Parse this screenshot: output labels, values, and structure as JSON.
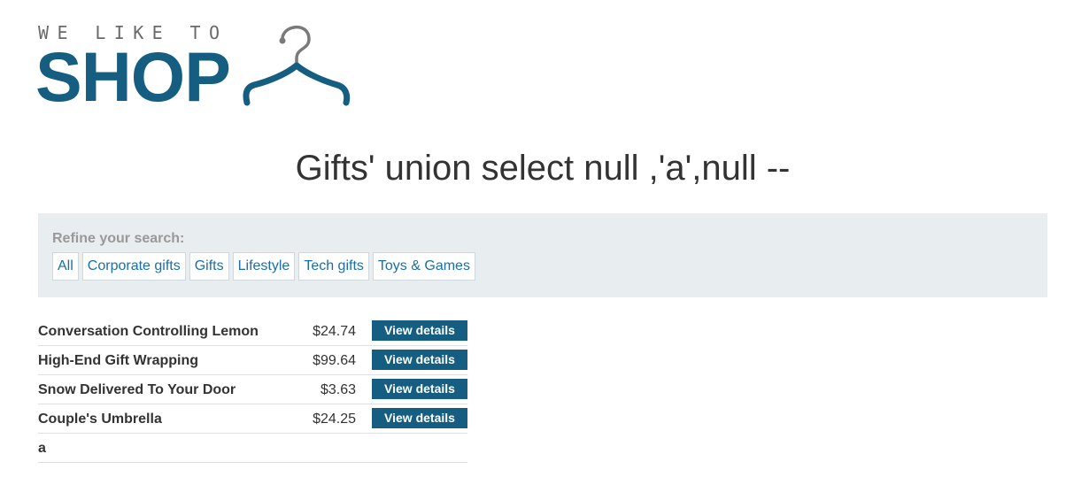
{
  "logo": {
    "tagline": "WE LIKE TO",
    "word": "SHOP",
    "colors": {
      "brand": "#155e82",
      "hook": "#7a7a7a",
      "tagline": "#6a6a6a"
    },
    "icon": "hanger-icon"
  },
  "page_title": "Gifts' union select null ,'a',null --",
  "filters": {
    "label": "Refine your search:",
    "items": [
      {
        "label": "All"
      },
      {
        "label": "Corporate gifts"
      },
      {
        "label": "Gifts"
      },
      {
        "label": "Lifestyle"
      },
      {
        "label": "Tech gifts"
      },
      {
        "label": "Toys & Games"
      }
    ]
  },
  "products": [
    {
      "name": "Conversation Controlling Lemon",
      "price": "$24.74",
      "button": "View details"
    },
    {
      "name": "High-End Gift Wrapping",
      "price": "$99.64",
      "button": "View details"
    },
    {
      "name": "Snow Delivered To Your Door",
      "price": "$3.63",
      "button": "View details"
    },
    {
      "name": "Couple's Umbrella",
      "price": "$24.25",
      "button": "View details"
    },
    {
      "name": "a",
      "price": "",
      "button": ""
    }
  ],
  "colors": {
    "accent": "#155e82",
    "link": "#1a6fa6",
    "panel_bg": "#e8edf0",
    "muted_label": "#999999"
  }
}
